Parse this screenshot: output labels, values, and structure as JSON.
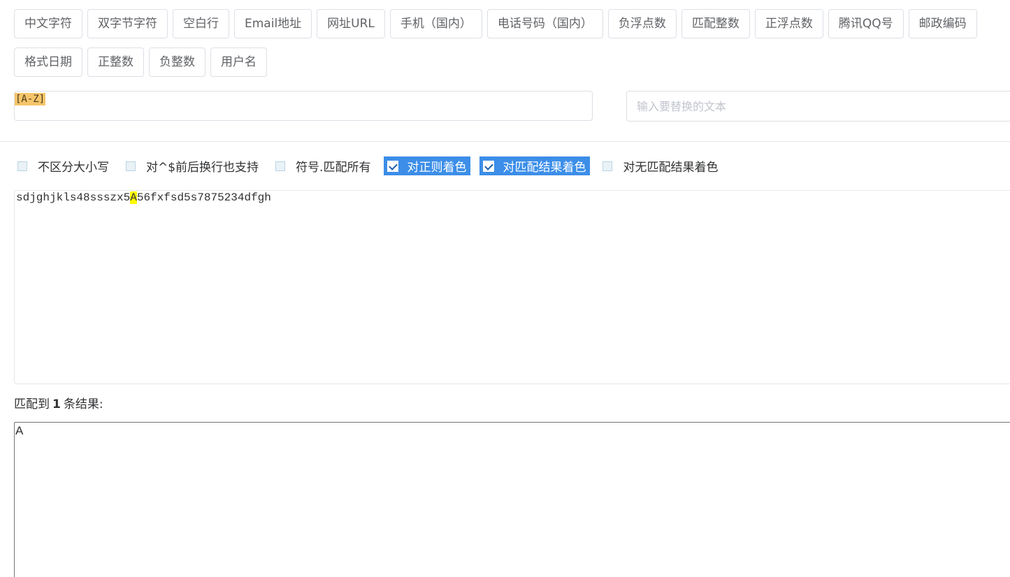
{
  "presets": [
    "中文字符",
    "双字节字符",
    "空白行",
    "Email地址",
    "网址URL",
    "手机（国内）",
    "电话号码（国内）",
    "负浮点数",
    "匹配整数",
    "正浮点数",
    "腾讯QQ号",
    "邮政编码",
    "格式日期",
    "正整数",
    "负整数",
    "用户名"
  ],
  "regex": {
    "value": "[A-Z]"
  },
  "replace": {
    "placeholder": "输入要替换的文本"
  },
  "options": [
    {
      "label": "不区分大小写",
      "checked": false
    },
    {
      "label": "对^$前后换行也支持",
      "checked": false
    },
    {
      "label": "符号.匹配所有",
      "checked": false
    },
    {
      "label": "对正则着色",
      "checked": true
    },
    {
      "label": "对匹配结果着色",
      "checked": true
    },
    {
      "label": "对无匹配结果着色",
      "checked": false
    }
  ],
  "source": {
    "before": "sdjghjkls48ssszx5",
    "match": "A",
    "after": "56fxfsd5s7875234dfgh"
  },
  "result": {
    "prefix": "匹配到",
    "count": "1",
    "suffix": "条结果:",
    "output": "A"
  }
}
